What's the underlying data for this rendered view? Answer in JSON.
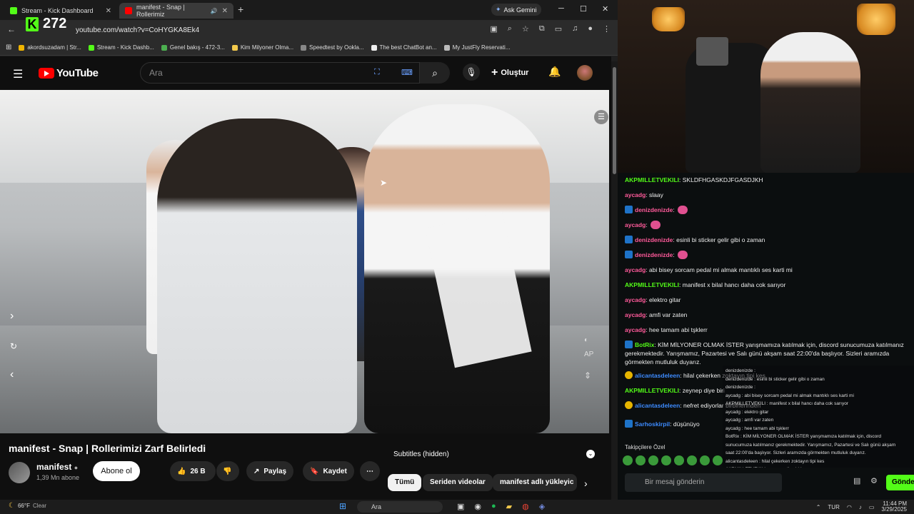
{
  "browser": {
    "tabs": [
      {
        "label": "Stream - Kick Dashboard",
        "color": "#53fc18"
      },
      {
        "label": "manifest - Snap | Rollerimiz",
        "color": "#ff0000"
      }
    ],
    "gemini_label": "Ask Gemini",
    "url": "youtube.com/watch?v=CoHYGKA8Ek4",
    "kick_viewers": "272",
    "bookmarks": [
      "akordsuzadam | Str...",
      "Stream - Kick Dashb...",
      "Genel bakış - 472-3...",
      "Kim Milyoner Olma...",
      "Speedtest by Ookla...",
      "The best ChatBot an...",
      "My JustFly Reservati..."
    ]
  },
  "youtube": {
    "logo_text": "YouTube",
    "search_placeholder": "Ara",
    "create_label": "Oluştur",
    "video": {
      "overlay_label": "AP",
      "title": "manifest - Snap | Rollerimizi Zarf Belirledi",
      "channel": "manifest",
      "subscribers": "1,39 Mn abone",
      "subscribe_label": "Abone ol",
      "likes": "26 B",
      "share_label": "Paylaş",
      "save_label": "Kaydet"
    },
    "subtitles_label": "Subtitles (hidden)",
    "chips": [
      "Tümü",
      "Seriden videolar",
      "manifest adlı yükleyic"
    ]
  },
  "chat": {
    "messages": [
      {
        "user": "AKPMILLETVEKILI",
        "color": "#53fc18",
        "text": "SKLDFHGASKDJFGASDJKH"
      },
      {
        "user": "aycadg",
        "color": "#ff5a9a",
        "text": "slaay"
      },
      {
        "user": "denizdenizde",
        "color": "#ff5a9a",
        "text": ""
      },
      {
        "user": "aycadg",
        "color": "#ff5a9a",
        "text": ""
      },
      {
        "user": "denizdenizde",
        "color": "#ff5a9a",
        "text": "esinli bi sticker gelir gibi o zaman"
      },
      {
        "user": "denizdenizde",
        "color": "#ff5a9a",
        "text": ""
      },
      {
        "user": "aycadg",
        "color": "#ff5a9a",
        "text": "abi bisey sorcam pedal mi almak mantıklı ses karti mi"
      },
      {
        "user": "AKPMILLETVEKILI",
        "color": "#53fc18",
        "text": "manifest x bilal hancı daha cok sarıyor"
      },
      {
        "user": "aycadg",
        "color": "#ff5a9a",
        "text": "elektro gitar"
      },
      {
        "user": "aycadg",
        "color": "#ff5a9a",
        "text": "amfi var zaten"
      },
      {
        "user": "aycadg",
        "color": "#ff5a9a",
        "text": "hee tamam abi tşklerr"
      },
      {
        "user": "BotRix",
        "color": "#53fc18",
        "text": "KİM MİLYONER OLMAK İSTER yarışmamıza katılmak için, discord sunucumuza katılmanız gerekmektedir. Yarışmamız, Pazartesi ve Salı günü akşam saat 22:00'da başlıyor. Sizleri aramızda görmekten mutluluk duyarız."
      },
      {
        "user": "alicantasdeleen",
        "color": "#3d8bff",
        "text": "hilal çekerken zoktayın tipi kes"
      },
      {
        "user": "AKPMILLETVEKILI",
        "color": "#53fc18",
        "text": "zeynep diye biri"
      },
      {
        "user": "alicantasdeleen",
        "color": "#3d8bff",
        "text": "nefret ediyorlar birbirlerinden"
      },
      {
        "user": "Sarhoskirpil",
        "color": "#3d8bff",
        "text": "düşünüyo"
      }
    ],
    "overlay_lines": [
      "denizdenizde :",
      "denizdenizde : esinli bi sticker gelir gibi o zaman",
      "denizdenizde :",
      "aycadg : abi bisey sorcam pedal mi almak mantıklı ses karti mi",
      "AKPMILLETVEKILI : manifest x bilal hancı daha cok sarıyor",
      "aycadg : elektro gitar",
      "aycadg : amfi var zaten",
      "aycadg : hee tamam abi tşklerr",
      "BotRix : KİM MİLYONER OLMAK İSTER yarışmamıza katılmak için, discord",
      "sunucumuza katılmanız gerekmektedir. Yarışmamız, Pazartesi ve Salı günü akşam",
      "saat 22:00'da başlıyor. Sizleri aramızda görmekten mutluluk duyarız.",
      "alicantasdeleen : hilal çekerken zoktayın tipi kes",
      "AKPMILLETVEKILI : zeynep diye biri",
      "alicantasdeleen : nefret ediyorlar birbirlerinden",
      "Sarhoskirpil : düşünüyo kim kaldı diye"
    ],
    "followers_label": "Takipçilere Özel",
    "input_placeholder": "Bir mesaj gönderin",
    "send_label": "Gönder"
  },
  "taskbar": {
    "temperature": "66°F",
    "weather": "Clear",
    "search_placeholder": "Ara",
    "language": "TUR",
    "time": "11:44 PM",
    "date": "3/29/2025"
  }
}
